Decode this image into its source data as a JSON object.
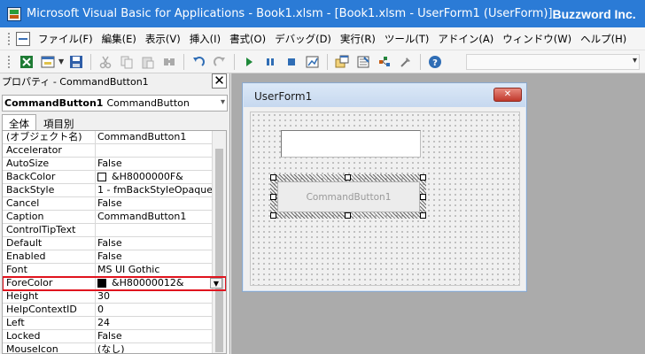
{
  "window": {
    "title": "Microsoft Visual Basic for Applications - Book1.xlsm - [Book1.xlsm - UserForm1 (UserForm)]",
    "brand": "Buzzword Inc."
  },
  "menu": {
    "items": [
      "ファイル(F)",
      "編集(E)",
      "表示(V)",
      "挿入(I)",
      "書式(O)",
      "デバッグ(D)",
      "実行(R)",
      "ツール(T)",
      "アドイン(A)",
      "ウィンドウ(W)",
      "ヘルプ(H)"
    ]
  },
  "toolbar": {
    "icons": [
      "excel-view-icon",
      "insert-userform-icon",
      "save-icon",
      "cut-icon",
      "copy-icon",
      "paste-icon",
      "find-icon",
      "undo-icon",
      "redo-icon",
      "run-icon",
      "pause-icon",
      "reset-icon",
      "design-mode-icon",
      "project-explorer-icon",
      "properties-icon",
      "object-browser-icon",
      "toolbox-icon",
      "help-icon"
    ]
  },
  "properties": {
    "title": "プロパティ - CommandButton1",
    "object_name": "CommandButton1",
    "object_type": "CommandButton",
    "tabs": [
      "全体",
      "項目別"
    ],
    "active_tab": 0,
    "selected_row": 11,
    "rows": [
      {
        "name": "(オブジェクト名)",
        "value": "CommandButton1"
      },
      {
        "name": "Accelerator",
        "value": ""
      },
      {
        "name": "AutoSize",
        "value": "False"
      },
      {
        "name": "BackColor",
        "value": "&H8000000F&",
        "swatch": "#ffffff"
      },
      {
        "name": "BackStyle",
        "value": "1 - fmBackStyleOpaque"
      },
      {
        "name": "Cancel",
        "value": "False"
      },
      {
        "name": "Caption",
        "value": "CommandButton1"
      },
      {
        "name": "ControlTipText",
        "value": ""
      },
      {
        "name": "Default",
        "value": "False"
      },
      {
        "name": "Enabled",
        "value": "False"
      },
      {
        "name": "Font",
        "value": "MS UI Gothic"
      },
      {
        "name": "ForeColor",
        "value": "&H80000012&",
        "swatch": "#000000"
      },
      {
        "name": "Height",
        "value": "30"
      },
      {
        "name": "HelpContextID",
        "value": "0"
      },
      {
        "name": "Left",
        "value": "24"
      },
      {
        "name": "Locked",
        "value": "False"
      },
      {
        "name": "MouseIcon",
        "value": "(なし)"
      }
    ]
  },
  "designer": {
    "form_title": "UserForm1",
    "close_glyph": "✕",
    "button_caption": "CommandButton1"
  },
  "colors": {
    "titlebar": "#2b7bd6",
    "selection_outline": "#e0141e"
  }
}
